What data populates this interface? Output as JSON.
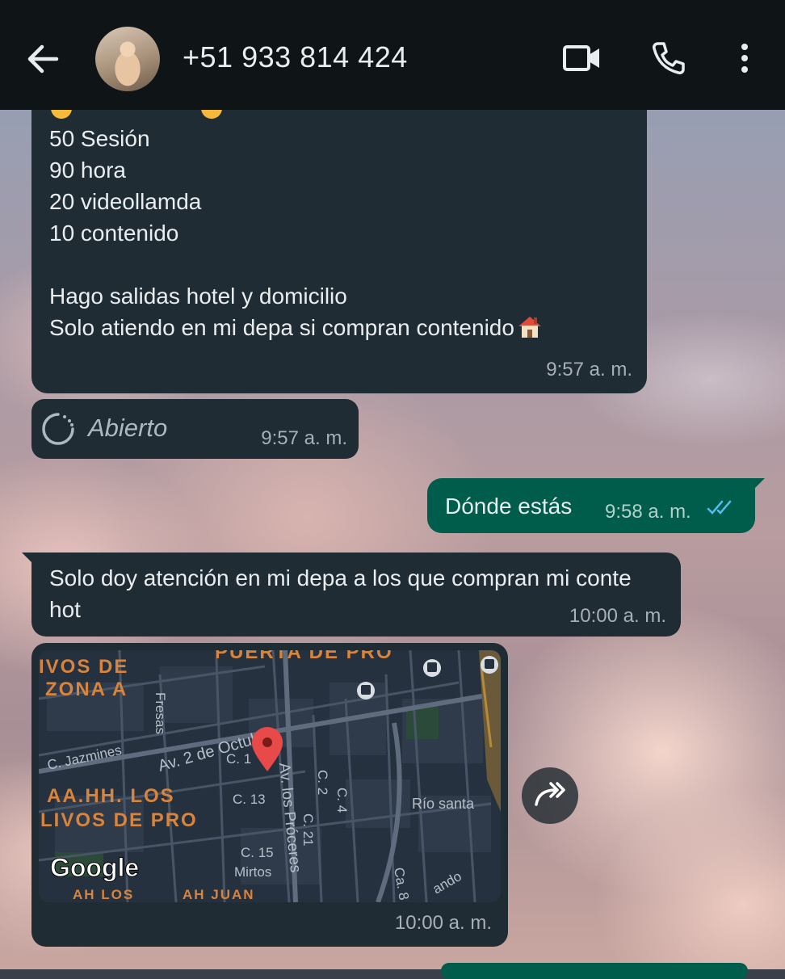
{
  "header": {
    "contact_name": "+51 933 814 424",
    "icons": [
      "back-arrow-icon",
      "video-call-icon",
      "phone-icon",
      "more-vert-icon"
    ]
  },
  "messages": [
    {
      "direction": "incoming",
      "lines": [
        "50 Sesión",
        "90 hora",
        "20 videollamda",
        "10 contenido",
        "",
        "Hago salidas hotel y domicilio",
        "Solo atiendo en mi depa si compran contenido"
      ],
      "time": "9:57 a. m."
    },
    {
      "direction": "incoming",
      "type": "view-once",
      "label": "Abierto",
      "time": "9:57 a. m."
    },
    {
      "direction": "outgoing",
      "text": "Dónde estás",
      "time": "9:58 a. m.",
      "status": "read"
    },
    {
      "direction": "incoming",
      "text": "Solo doy atención en mi depa a los que compran mi conte hot",
      "time": "10:00 a. m."
    },
    {
      "direction": "incoming",
      "type": "location",
      "time": "10:00 a. m.",
      "map_labels": {
        "district_top": "PUERTA DE PRO",
        "district_left_1": "IVOS DE",
        "district_left_2": "ZONA A",
        "aahh_1": "AA.HH. LOS",
        "aahh_2": "LIVOS DE PRO",
        "street_fresas": "Fresas",
        "street_jazmines": "C. Jazmines",
        "street_av2oct": "Av. 2 de Octubre",
        "street_c1": "C. 1",
        "street_c13": "C. 13",
        "street_proceres": "Av. los Próceres",
        "street_c2": "C. 2",
        "street_c4": "C. 4",
        "street_c21": "C. 21",
        "street_c15": "C. 15",
        "street_mirtos": "Mirtos",
        "street_rio": "Río santa",
        "street_ca8": "Ca. 8",
        "street_ando": "ando",
        "bottom_1": "AH LOS",
        "bottom_2": "AH JUAN",
        "google": "Google"
      }
    }
  ],
  "colors": {
    "topbar": "#0f1417",
    "incoming_bubble": "#202c33",
    "outgoing_bubble": "#005c4b",
    "read_ticks": "#53bdeb"
  }
}
